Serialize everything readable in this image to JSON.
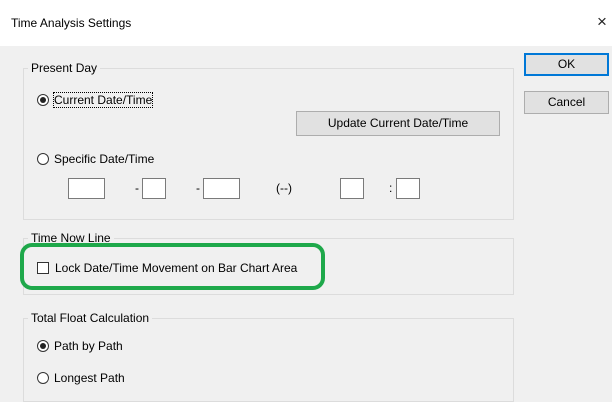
{
  "window": {
    "title": "Time Analysis Settings",
    "close_glyph": "×",
    "close_icon": "close-icon"
  },
  "buttons": {
    "ok": "OK",
    "cancel": "Cancel"
  },
  "present_day": {
    "legend": "Present Day",
    "current_label": "Current Date/Time",
    "current_selected": true,
    "update_button": "Update Current Date/Time",
    "specific_label": "Specific Date/Time",
    "specific_selected": false,
    "fields": {
      "f1": "",
      "f2": "",
      "f3": "",
      "f4": "",
      "f5": ""
    },
    "separators": {
      "dash1": "-",
      "dash2": "-",
      "weekday": "(--)",
      "colon": ":"
    }
  },
  "time_now_line": {
    "legend": "Time Now Line",
    "lock_label": "Lock Date/Time Movement on Bar Chart Area",
    "lock_checked": false,
    "highlight_color": "#1ea84a"
  },
  "total_float": {
    "legend": "Total Float Calculation",
    "path_by_path_label": "Path by Path",
    "path_by_path_selected": true,
    "longest_path_label": "Longest Path",
    "longest_path_selected": false
  }
}
